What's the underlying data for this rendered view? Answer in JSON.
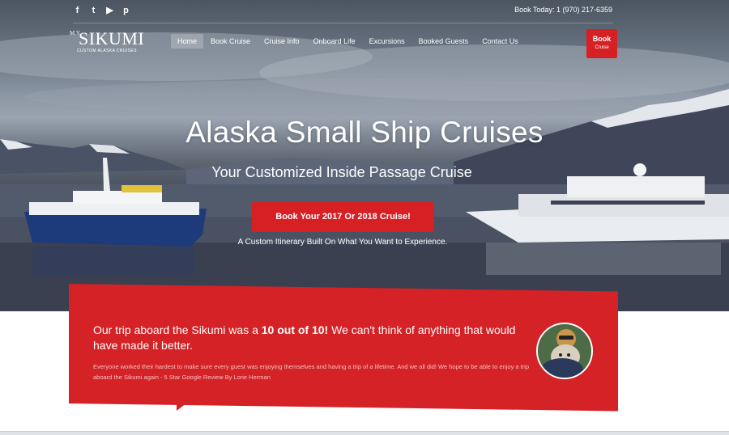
{
  "topbar": {
    "social": [
      {
        "icon": "facebook-icon",
        "glyph": "f"
      },
      {
        "icon": "twitter-icon",
        "glyph": "t"
      },
      {
        "icon": "youtube-icon",
        "glyph": "▶"
      },
      {
        "icon": "pinterest-icon",
        "glyph": "p"
      }
    ],
    "phone": "Book Today: 1 (970) 217-6359"
  },
  "logo": {
    "mv": "M.V.",
    "name": "SIKUMI",
    "tagline": "CUSTOM ALASKA CRUISES"
  },
  "nav": {
    "items": [
      "Home",
      "Book Cruise",
      "Cruise Info",
      "Onboard Life",
      "Excursions",
      "Booked Guests",
      "Contact Us"
    ],
    "active": "Home"
  },
  "book_button": {
    "line1": "Book",
    "line2": "Cruise"
  },
  "hero": {
    "title": "Alaska Small Ship Cruises",
    "subtitle": "Your Customized Inside Passage Cruise",
    "cta": "Book Your 2017 Or 2018 Cruise!",
    "caption": "A Custom Itinerary Built On What You Want to Experience."
  },
  "testimonial": {
    "quote_before": "Our trip aboard the Sikumi was a ",
    "quote_bold": "10 out of 10!",
    "quote_after": " We can't think of anything that would have made it better.",
    "text": "Everyone worked their hardest to make sure every guest was enjoying themselves and having a trip of a lifetime. And we all did! We hope to be able to enjoy a trip aboard the Sikumi again - 5 Star Google Review By Lorie Herman"
  },
  "colors": {
    "accent": "#d62024",
    "testimonial_bg": "#d42226"
  }
}
